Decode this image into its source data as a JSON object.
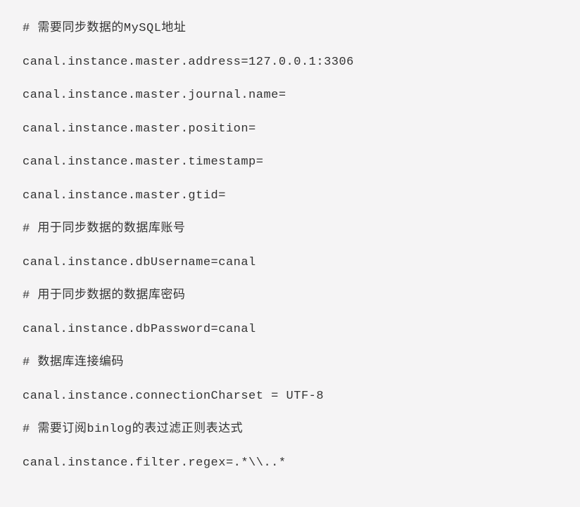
{
  "lines": [
    "# 需要同步数据的MySQL地址",
    "canal.instance.master.address=127.0.0.1:3306",
    "canal.instance.master.journal.name=",
    "canal.instance.master.position=",
    "canal.instance.master.timestamp=",
    "canal.instance.master.gtid=",
    "# 用于同步数据的数据库账号",
    "canal.instance.dbUsername=canal",
    "# 用于同步数据的数据库密码",
    "canal.instance.dbPassword=canal",
    "# 数据库连接编码",
    "canal.instance.connectionCharset = UTF-8",
    "# 需要订阅binlog的表过滤正则表达式",
    "canal.instance.filter.regex=.*\\\\..*"
  ]
}
